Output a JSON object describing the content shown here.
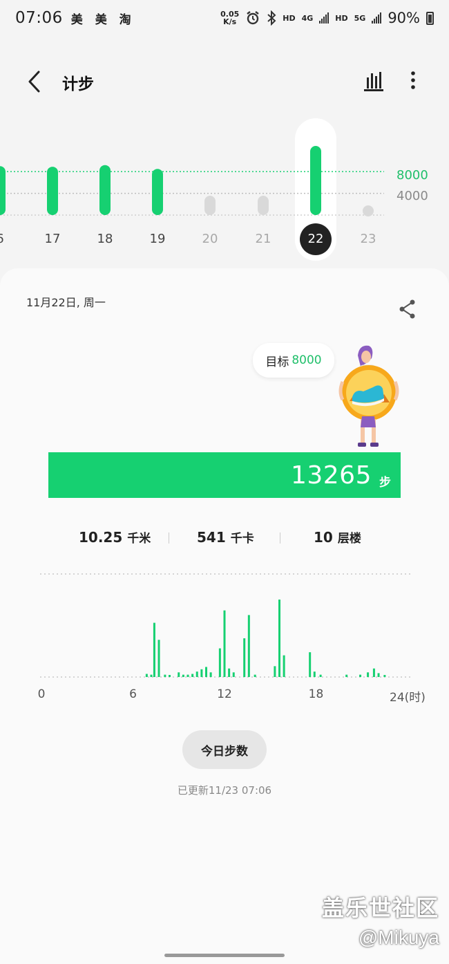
{
  "status_bar": {
    "time": "07:06",
    "apps": "美 美 淘",
    "net_speed_value": "0.05",
    "net_speed_unit": "K/s",
    "hd1": "HD",
    "net1": "4G",
    "hd2": "HD",
    "net2": "5G",
    "battery": "90%"
  },
  "header": {
    "title": "计步"
  },
  "week_chart": {
    "days": [
      {
        "label": "6",
        "steps": 9000,
        "state": "past"
      },
      {
        "label": "17",
        "steps": 8900,
        "state": "past"
      },
      {
        "label": "18",
        "steps": 9200,
        "state": "past"
      },
      {
        "label": "19",
        "steps": 8500,
        "state": "past"
      },
      {
        "label": "20",
        "steps": 0,
        "state": "future"
      },
      {
        "label": "21",
        "steps": 0,
        "state": "future"
      },
      {
        "label": "22",
        "steps": 13265,
        "state": "selected"
      },
      {
        "label": "23",
        "steps": 0,
        "state": "future-dot"
      }
    ],
    "goal_line_label": "8000",
    "half_line_label": "4000",
    "accent_color": "#16d071",
    "inactive_color": "#d9d9d9"
  },
  "card": {
    "date": "11月22日, 周一",
    "goal_label": "目标",
    "goal_value": "8000",
    "steps": "13265",
    "steps_unit": "步",
    "stats": [
      {
        "value": "10.25",
        "unit": "千米"
      },
      {
        "value": "541",
        "unit": "千卡"
      },
      {
        "value": "10",
        "unit": "层楼"
      }
    ]
  },
  "hourly_chart": {
    "axis_labels": [
      "0",
      "6",
      "12",
      "18",
      "24(时)"
    ],
    "bars": [
      {
        "h": 6.9,
        "v": 0.04
      },
      {
        "h": 7.2,
        "v": 0.03
      },
      {
        "h": 7.4,
        "v": 0.7
      },
      {
        "h": 7.7,
        "v": 0.48
      },
      {
        "h": 8.1,
        "v": 0.03
      },
      {
        "h": 8.4,
        "v": 0.02
      },
      {
        "h": 9.0,
        "v": 0.06
      },
      {
        "h": 9.3,
        "v": 0.03
      },
      {
        "h": 9.6,
        "v": 0.03
      },
      {
        "h": 9.9,
        "v": 0.04
      },
      {
        "h": 10.2,
        "v": 0.07
      },
      {
        "h": 10.5,
        "v": 0.1
      },
      {
        "h": 10.8,
        "v": 0.13
      },
      {
        "h": 11.1,
        "v": 0.06
      },
      {
        "h": 11.7,
        "v": 0.37
      },
      {
        "h": 12.0,
        "v": 0.86
      },
      {
        "h": 12.3,
        "v": 0.11
      },
      {
        "h": 12.6,
        "v": 0.06
      },
      {
        "h": 13.3,
        "v": 0.5
      },
      {
        "h": 13.6,
        "v": 0.8
      },
      {
        "h": 14.0,
        "v": 0.03
      },
      {
        "h": 15.3,
        "v": 0.14
      },
      {
        "h": 15.6,
        "v": 1.0
      },
      {
        "h": 15.9,
        "v": 0.28
      },
      {
        "h": 17.6,
        "v": 0.32
      },
      {
        "h": 17.9,
        "v": 0.07
      },
      {
        "h": 18.3,
        "v": 0.03
      },
      {
        "h": 20.0,
        "v": 0.03
      },
      {
        "h": 20.9,
        "v": 0.03
      },
      {
        "h": 21.4,
        "v": 0.06
      },
      {
        "h": 21.8,
        "v": 0.11
      },
      {
        "h": 22.1,
        "v": 0.05
      },
      {
        "h": 22.5,
        "v": 0.02
      }
    ]
  },
  "today_button": "今日步数",
  "updated_text": "已更新11/23 07:06",
  "watermark": {
    "line1": "盖乐世社区",
    "line2": "@Mikuya"
  },
  "icons": {
    "back": "back-arrow-icon",
    "chart": "bar-chart-icon",
    "more": "more-vertical-icon",
    "share": "share-icon",
    "alarm": "alarm-icon",
    "bluetooth": "bluetooth-icon"
  }
}
